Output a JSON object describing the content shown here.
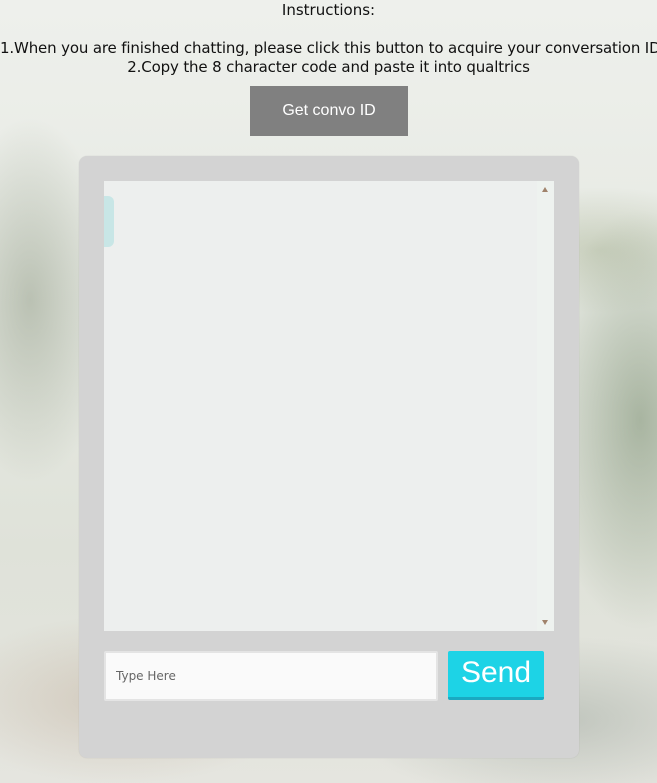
{
  "instructions": {
    "title": "Instructions:",
    "step1": "1.When you are finished chatting, please click this button to acquire your conversation ID",
    "step2": "2.Copy the 8 character code and paste it into qualtrics"
  },
  "convo_button": {
    "label": "Get convo ID",
    "color": "#808080"
  },
  "chat": {
    "messages": [],
    "input_placeholder": "Type Here",
    "input_value": "",
    "send_label": "Send",
    "send_color": "#1dd3e6"
  }
}
